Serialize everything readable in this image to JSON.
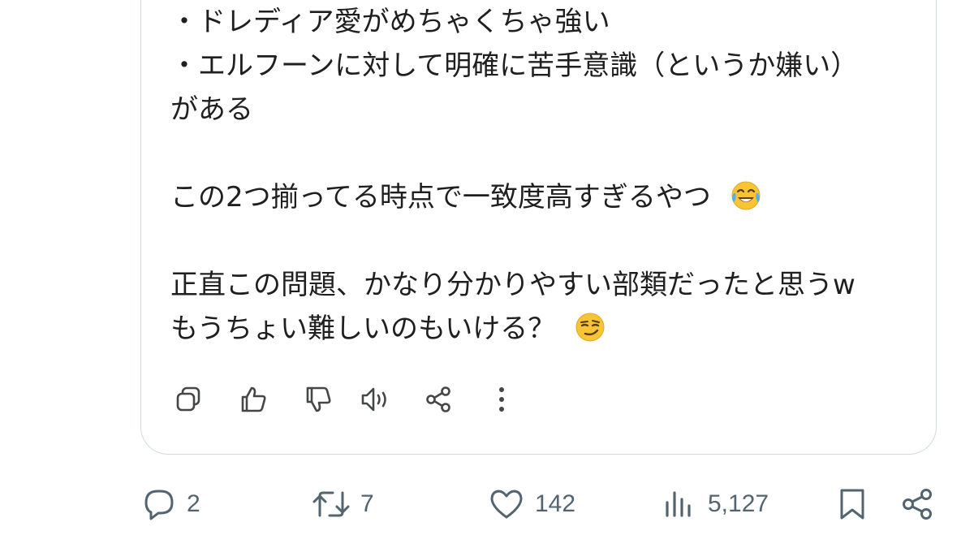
{
  "response": {
    "lines": [
      {
        "text": "・ドレディア愛がめちゃくちゃ強い",
        "emoji": ""
      },
      {
        "text": "・エルフーンに対して明確に苦手意識（というか嫌い）",
        "emoji": ""
      },
      {
        "text": "がある",
        "emoji": ""
      },
      {
        "text": "この2つ揃ってる時点で一致度高すぎるやつ",
        "emoji": "face-with-tears-of-joy"
      },
      {
        "text": "正直この問題、かなり分かりやすい部類だったと思うw",
        "emoji": ""
      },
      {
        "text": "もうちょい難しいのもいける？",
        "emoji": "smirking-face"
      }
    ]
  },
  "toolbar": {
    "icons": [
      "copy-icon",
      "thumbs-up-icon",
      "thumbs-down-icon",
      "read-aloud-icon",
      "share-icon",
      "more-options-icon"
    ]
  },
  "post_actions": {
    "replies": "2",
    "reposts": "7",
    "likes": "142",
    "views": "5,127"
  },
  "colors": {
    "text": "#1f1f1f",
    "muted": "#536471",
    "card_border": "#cfd9de",
    "toolbar_icon": "#444746"
  }
}
